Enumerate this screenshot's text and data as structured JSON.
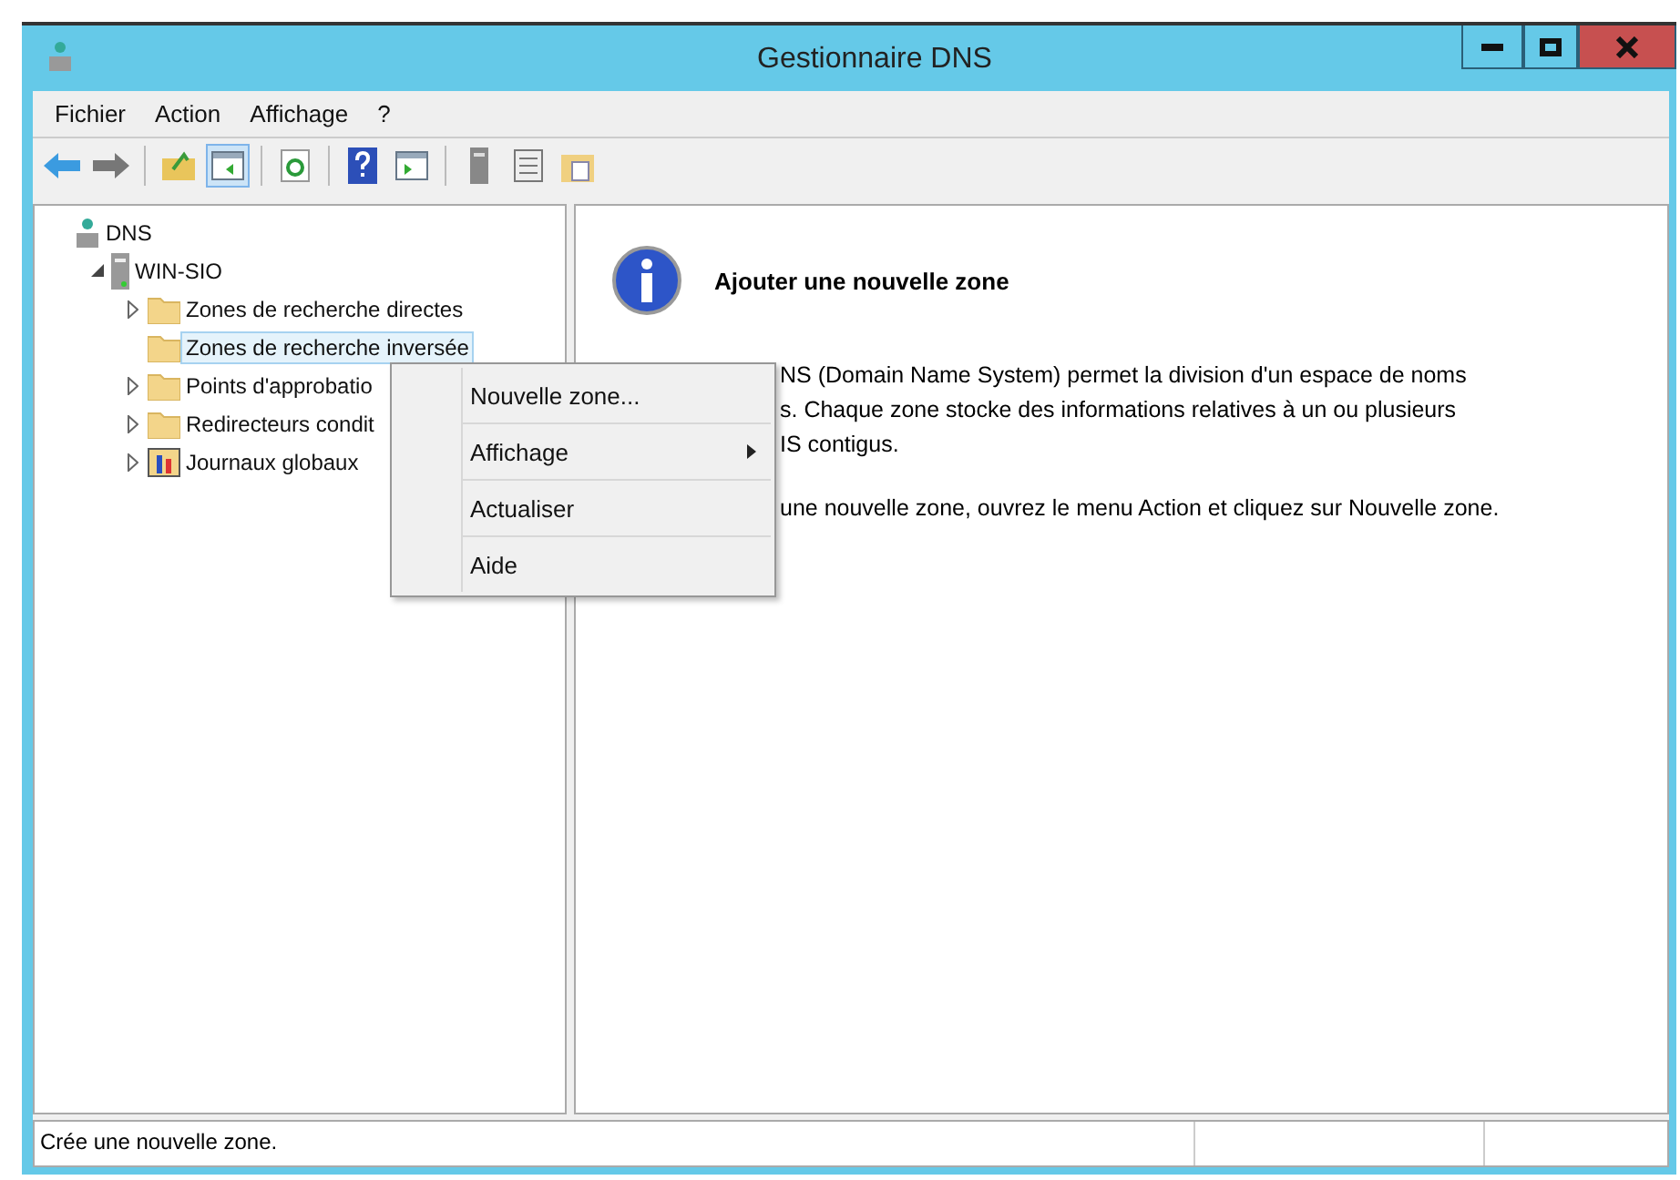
{
  "window": {
    "title": "Gestionnaire DNS"
  },
  "menubar": [
    {
      "label": "Fichier"
    },
    {
      "label": "Action"
    },
    {
      "label": "Affichage"
    },
    {
      "label": "?"
    }
  ],
  "toolbar": [
    {
      "kind": "back",
      "selected": false
    },
    {
      "kind": "forward",
      "selected": false
    },
    {
      "kind": "sep"
    },
    {
      "kind": "up",
      "selected": false
    },
    {
      "kind": "tree",
      "selected": true
    },
    {
      "kind": "sep"
    },
    {
      "kind": "refresh",
      "selected": false
    },
    {
      "kind": "sep"
    },
    {
      "kind": "help",
      "selected": false
    },
    {
      "kind": "pane",
      "selected": false
    },
    {
      "kind": "sep"
    },
    {
      "kind": "server",
      "selected": false
    },
    {
      "kind": "list",
      "selected": false
    },
    {
      "kind": "folder",
      "selected": false
    }
  ],
  "tree": [
    {
      "label": "DNS",
      "kind": "root",
      "selected": false,
      "children": [
        {
          "label": "WIN-SIO",
          "kind": "server",
          "expanded": true,
          "selected": false,
          "children": [
            {
              "label": "Zones de recherche directes",
              "kind": "folder",
              "expanded": false,
              "selected": false
            },
            {
              "label": "Zones de recherche inversée",
              "kind": "folder",
              "selected": true
            },
            {
              "label": "Points d'approbatio",
              "kind": "folder",
              "expanded": false,
              "selected": false
            },
            {
              "label": "Redirecteurs condit",
              "kind": "folder",
              "expanded": false,
              "selected": false
            },
            {
              "label": "Journaux globaux",
              "kind": "log",
              "expanded": false,
              "selected": false
            }
          ]
        }
      ]
    }
  ],
  "context_menu": [
    {
      "label": "Nouvelle zone...",
      "submenu": false
    },
    {
      "label": "Affichage",
      "submenu": true
    },
    {
      "label": "Actualiser",
      "submenu": false
    },
    {
      "label": "Aide",
      "submenu": false
    }
  ],
  "info": {
    "title": "Ajouter une nouvelle zone",
    "lines": [
      "NS (Domain Name System) permet la division d'un espace de noms",
      "s. Chaque zone stocke des informations relatives à un ou plusieurs",
      "IS contigus.",
      "une nouvelle zone, ouvrez le menu Action et cliquez sur Nouvelle zone."
    ]
  },
  "status_bar": {
    "text": "Crée une nouvelle zone."
  }
}
